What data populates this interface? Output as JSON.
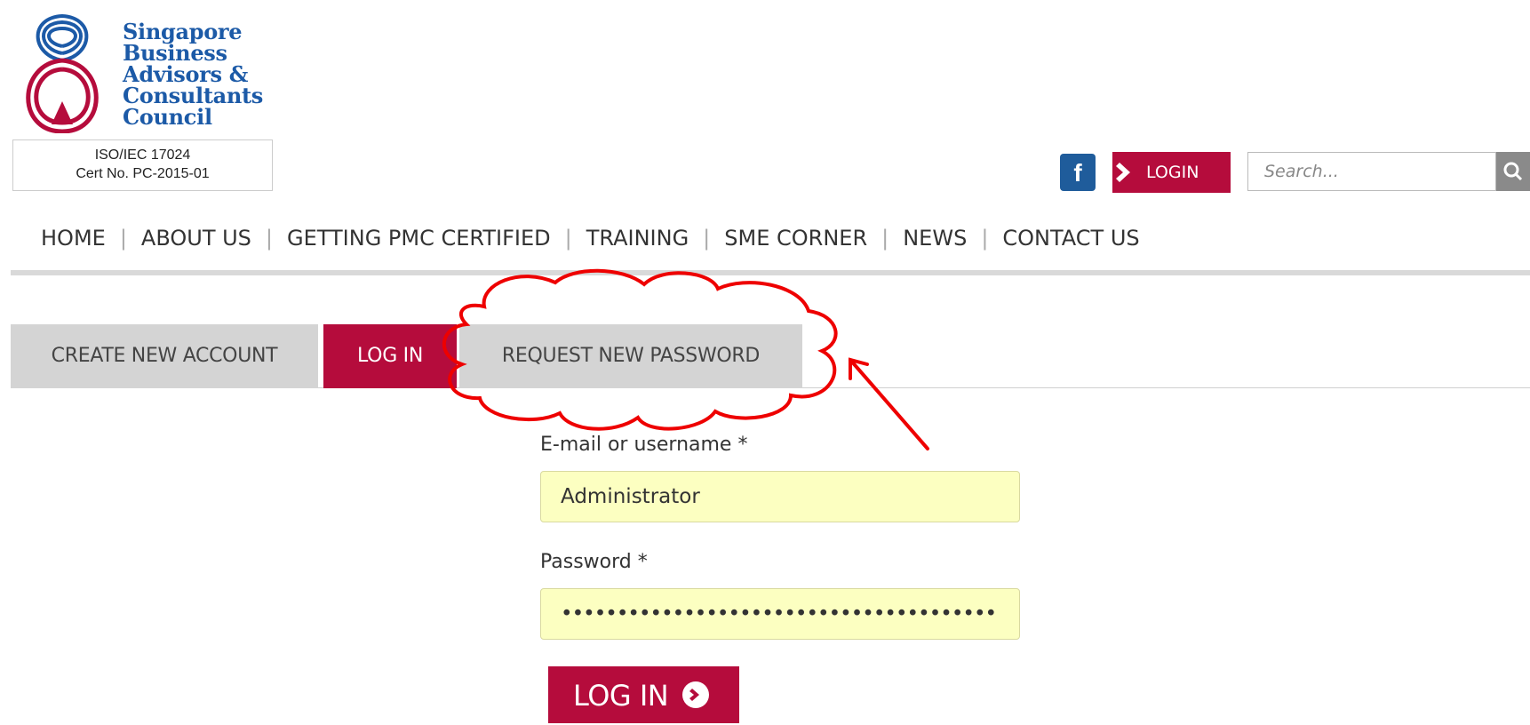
{
  "logo": {
    "lines": [
      "Singapore",
      "Business",
      "Advisors &",
      "Consultants",
      "Council"
    ],
    "cert_line1": "ISO/IEC 17024",
    "cert_line2": "Cert No. PC-2015-01"
  },
  "header": {
    "facebook_label": "f",
    "login_label": "LOGIN",
    "search_placeholder": "Search..."
  },
  "nav": {
    "items": [
      "HOME",
      "ABOUT US",
      "GETTING PMC CERTIFIED",
      "TRAINING",
      "SME CORNER",
      "NEWS",
      "CONTACT US"
    ],
    "separator": "|"
  },
  "tabs": [
    "CREATE NEW ACCOUNT",
    "LOG IN",
    "REQUEST NEW PASSWORD"
  ],
  "form": {
    "username_label": "E-mail or username *",
    "username_value": "Administrator",
    "password_label": "Password *",
    "password_value": "•••••••••••••••••••••••••••••••••••••••",
    "submit_label": "LOG IN"
  },
  "colors": {
    "brand_red": "#b50c3c",
    "logo_blue": "#1c5aa7",
    "annotation_red": "#ee0000",
    "input_bg": "#fcffc1"
  }
}
